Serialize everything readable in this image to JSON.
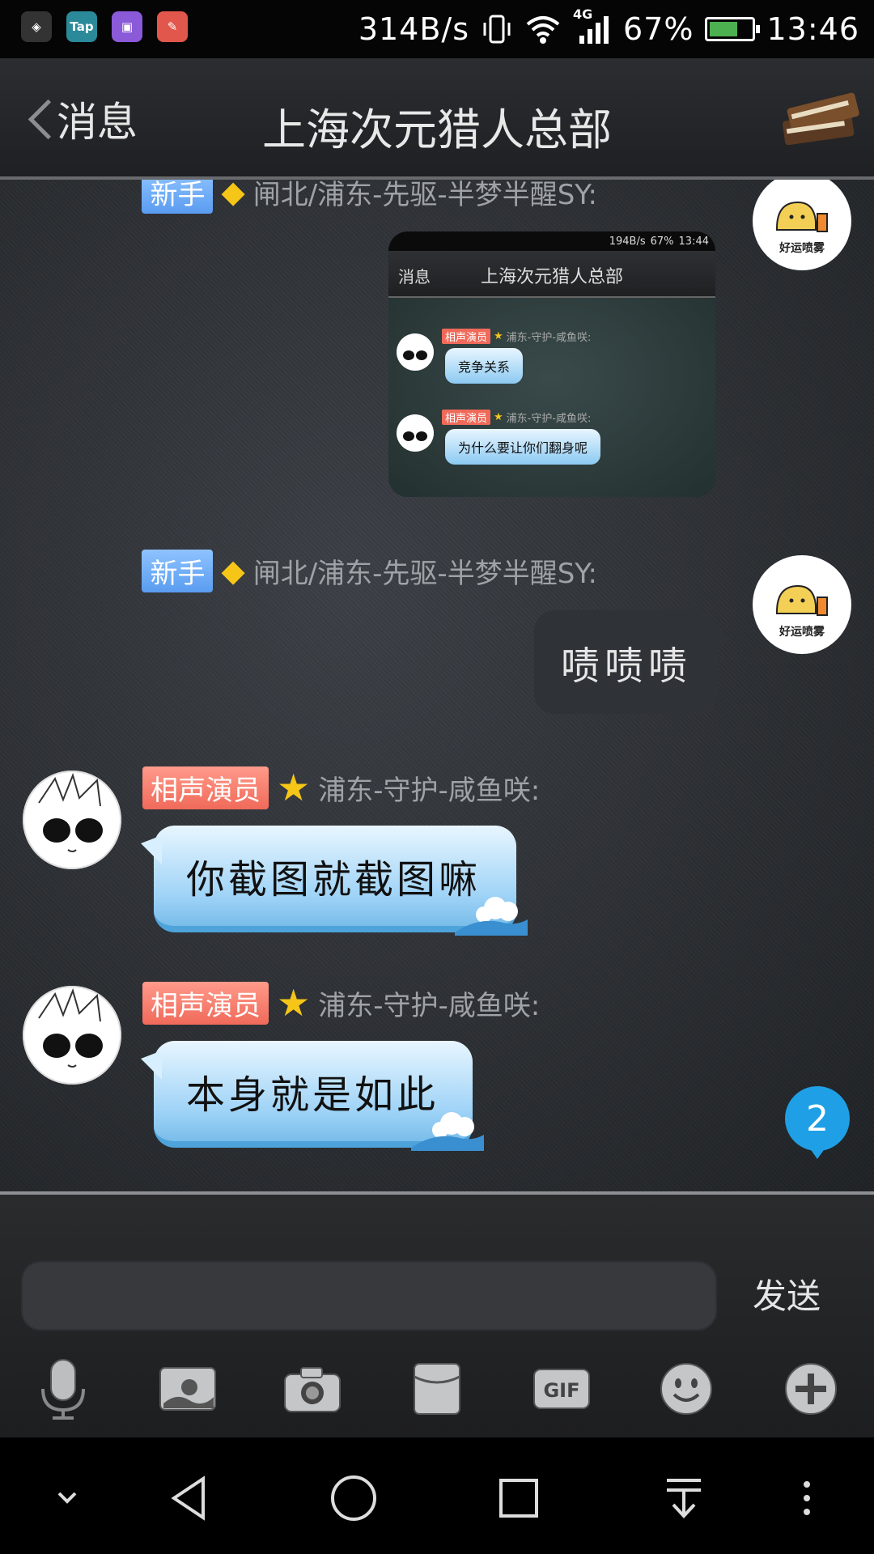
{
  "status_bar": {
    "net_speed": "314B/s",
    "network": "4G",
    "battery": "67%",
    "battery_level": 0.67,
    "time": "13:46"
  },
  "header": {
    "back_label": "消息",
    "title": "上海次元猎人总部"
  },
  "messages": [
    {
      "badge": "新手",
      "sender": "闸北/浦东-先驱-半梦半醒SY:",
      "type": "image",
      "avatar_caption": "好运喷雾",
      "screenshot": {
        "net_speed": "194B/s",
        "battery": "67%",
        "time": "13:44",
        "back_label": "消息",
        "title": "上海次元猎人总部",
        "items": [
          {
            "badge": "相声演员",
            "sender": "浦东-守护-咸鱼咲:",
            "text": "竞争关系"
          },
          {
            "badge": "相声演员",
            "sender": "浦东-守护-咸鱼咲:",
            "text": "为什么要让你们翻身呢"
          }
        ]
      }
    },
    {
      "badge": "新手",
      "sender": "闸北/浦东-先驱-半梦半醒SY:",
      "type": "text",
      "avatar_caption": "好运喷雾",
      "text": "啧啧啧"
    },
    {
      "badge": "相声演员",
      "sender": "浦东-守护-咸鱼咲:",
      "type": "text",
      "text": "你截图就截图嘛"
    },
    {
      "badge": "相声演员",
      "sender": "浦东-守护-咸鱼咲:",
      "type": "text",
      "text": "本身就是如此"
    }
  ],
  "unread_count": "2",
  "composer": {
    "send_label": "发送",
    "gif_label": "GIF",
    "tools": [
      "microphone-icon",
      "image-icon",
      "camera-icon",
      "red-packet-icon",
      "gif-icon",
      "emoji-icon",
      "plus-icon"
    ]
  },
  "colors": {
    "accent_blue": "#1fa0e6",
    "badge_newbie": "#5a9cf0",
    "badge_title": "#f06a5a"
  }
}
